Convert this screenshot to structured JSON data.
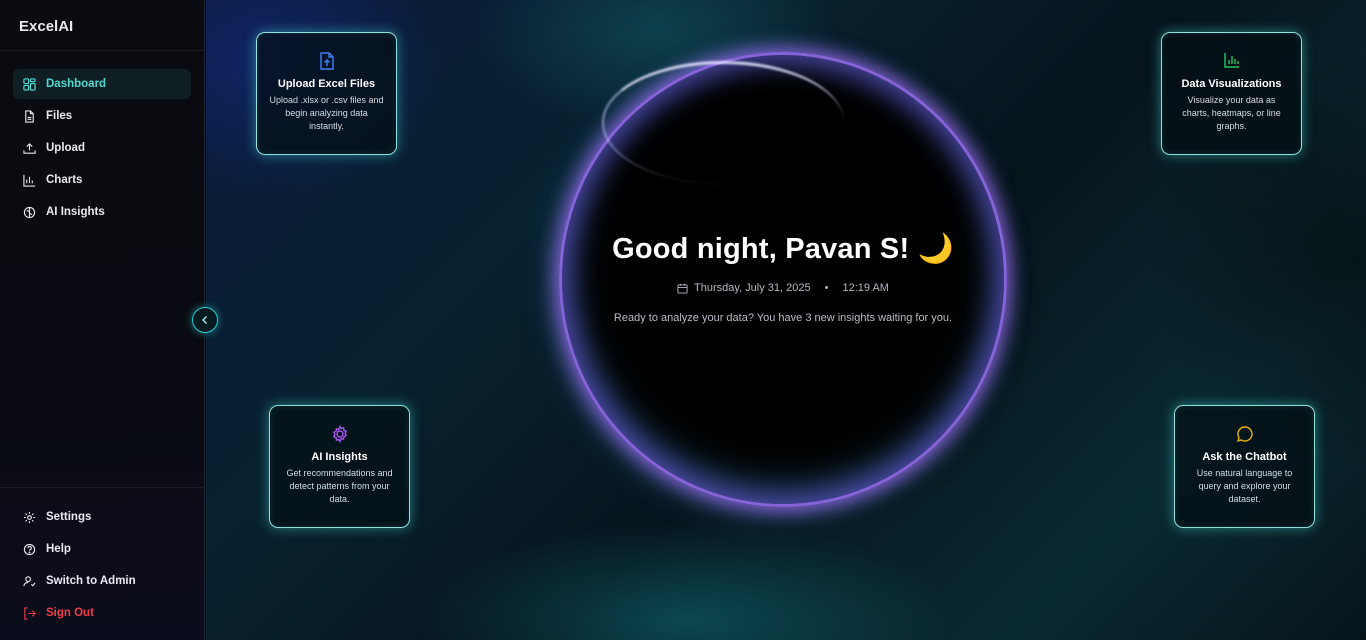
{
  "app": {
    "title": "ExcelAI"
  },
  "sidebar": {
    "nav": [
      {
        "label": "Dashboard",
        "icon": "grid-icon"
      },
      {
        "label": "Files",
        "icon": "file-icon"
      },
      {
        "label": "Upload",
        "icon": "upload-icon"
      },
      {
        "label": "Charts",
        "icon": "bar-chart-icon"
      },
      {
        "label": "AI Insights",
        "icon": "brain-icon"
      }
    ],
    "bottom": [
      {
        "label": "Settings",
        "icon": "gear-icon"
      },
      {
        "label": "Help",
        "icon": "help-circle-icon"
      },
      {
        "label": "Switch to Admin",
        "icon": "user-switch-icon"
      },
      {
        "label": "Sign Out",
        "icon": "sign-out-icon"
      }
    ]
  },
  "hero": {
    "greeting": "Good night, Pavan S! 🌙",
    "date": "Thursday, July 31, 2025",
    "separator": "•",
    "time": "12:19 AM",
    "tagline": "Ready to analyze your data? You have 3 new insights waiting for you."
  },
  "cards": [
    {
      "title": "Upload Excel Files",
      "desc": "Upload .xlsx or .csv files and begin analyzing data instantly.",
      "icon": "file-upload-icon",
      "color": "#3b82f6"
    },
    {
      "title": "Data Visualizations",
      "desc": "Visualize your data as charts, heatmaps, or line graphs.",
      "icon": "bar-chart-icon",
      "color": "#22c55e"
    },
    {
      "title": "AI Insights",
      "desc": "Get recommendations and detect patterns from your data.",
      "icon": "brain-icon",
      "color": "#a855f7"
    },
    {
      "title": "Ask the Chatbot",
      "desc": "Use natural language to query and explore your dataset.",
      "icon": "chat-bubble-icon",
      "color": "#eab308"
    }
  ],
  "colors": {
    "accent": "#4fd8d2",
    "danger": "#ef3e4a",
    "card_border": "#8fe0dc"
  }
}
